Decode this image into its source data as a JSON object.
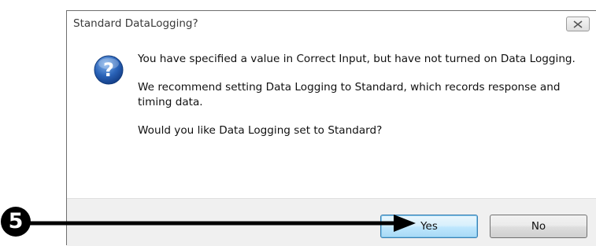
{
  "dialog": {
    "title": "Standard DataLogging?",
    "close_label": "☒",
    "icon": "question-icon",
    "message": [
      "You have specified a value in Correct Input, but have not turned on Data Logging.",
      "We recommend setting Data Logging to Standard, which records response and timing data.",
      "Would you like Data Logging set to Standard?"
    ],
    "buttons": {
      "yes": "Yes",
      "no": "No"
    }
  },
  "annotation": {
    "step_number": "5",
    "arrow": "arrow-right-icon"
  },
  "colors": {
    "icon_blue": "#2a63b8",
    "yes_button_border": "#3c7fb1",
    "footer_bg": "#f0f0f0"
  }
}
